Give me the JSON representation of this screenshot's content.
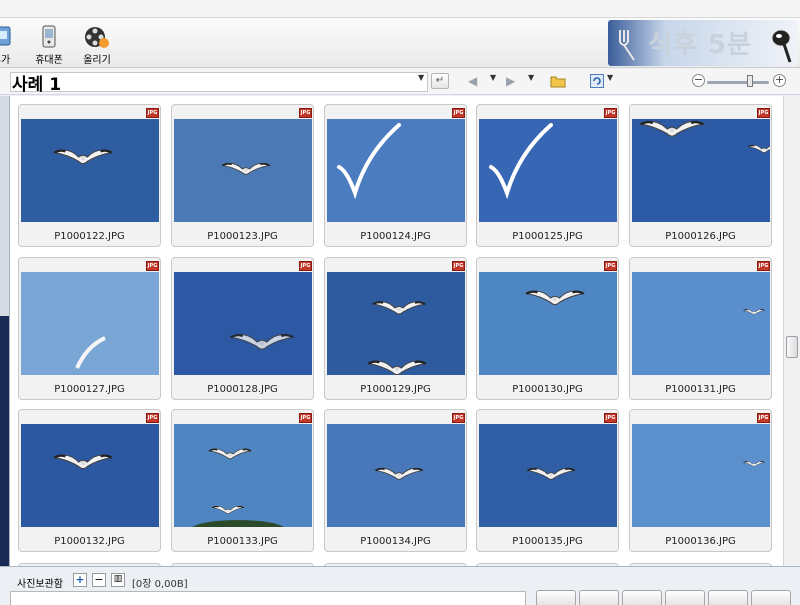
{
  "toolbar": {
    "add_label": "추가",
    "phone_label": "휴대폰",
    "upload_label": "올리기",
    "banner_text": "식후 5분"
  },
  "path": {
    "current": "사례 1"
  },
  "photos": [
    {
      "name": "P1000122.JPG",
      "scene": "bird-spread",
      "sky": "#2f5da2",
      "check": false
    },
    {
      "name": "P1000123.JPG",
      "scene": "bird-small",
      "sky": "#4a79b5",
      "check": false
    },
    {
      "name": "P1000124.JPG",
      "scene": "check",
      "sky": "#4b7cc0",
      "check": true
    },
    {
      "name": "P1000125.JPG",
      "scene": "check",
      "sky": "#3766b4",
      "check": true
    },
    {
      "name": "P1000126.JPG",
      "scene": "bird-top",
      "sky": "#2d5aa4",
      "check": false
    },
    {
      "name": "P1000127.JPG",
      "scene": "bird-corner",
      "sky": "#7aa6d6",
      "check": false
    },
    {
      "name": "P1000128.JPG",
      "scene": "bird-blur",
      "sky": "#2d58a3",
      "check": false
    },
    {
      "name": "P1000129.JPG",
      "scene": "two-birds",
      "sky": "#2e5aa0",
      "check": false
    },
    {
      "name": "P1000130.JPG",
      "scene": "bird-high",
      "sky": "#4e86c4",
      "check": false
    },
    {
      "name": "P1000131.JPG",
      "scene": "bird-tiny",
      "sky": "#5b8ecc",
      "check": false
    },
    {
      "name": "P1000132.JPG",
      "scene": "bird-spread",
      "sky": "#2c58a2",
      "check": false
    },
    {
      "name": "P1000133.JPG",
      "scene": "birds-trees",
      "sky": "#4f86c2",
      "check": false
    },
    {
      "name": "P1000134.JPG",
      "scene": "bird-small",
      "sky": "#4878b9",
      "check": false
    },
    {
      "name": "P1000135.JPG",
      "scene": "bird-small",
      "sky": "#2f5ea5",
      "check": false
    },
    {
      "name": "P1000136.JPG",
      "scene": "bird-tiny",
      "sky": "#5c90cc",
      "check": false
    }
  ],
  "badge": "JPG",
  "bottom": {
    "label": "사진보관함",
    "count": "[0장 0,00B]"
  },
  "icons": [
    "add-icon",
    "phone-icon",
    "film-upload-icon",
    "back-icon",
    "forward-icon",
    "folder-icon",
    "refresh-icon",
    "zoom-out-icon",
    "zoom-in-icon",
    "plus-icon",
    "minus-icon",
    "trash-icon"
  ]
}
